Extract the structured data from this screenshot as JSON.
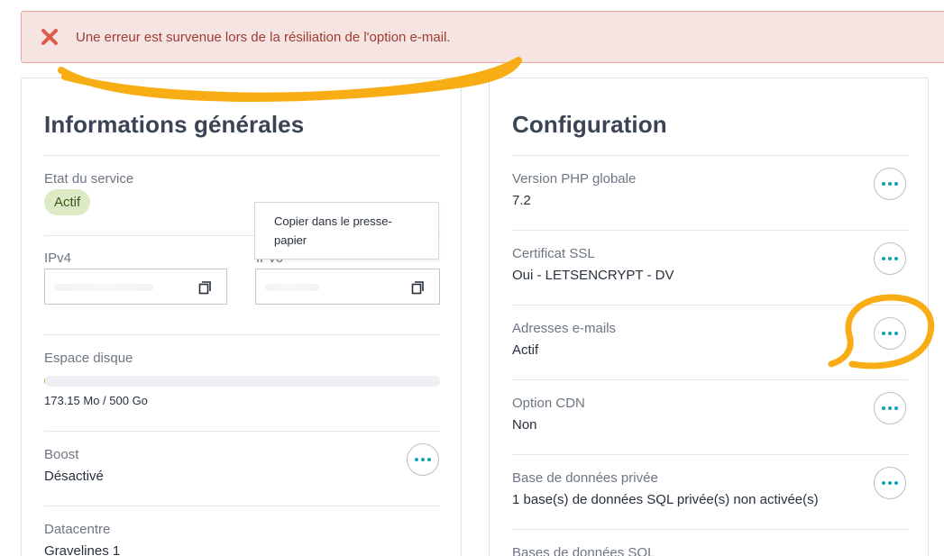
{
  "alert": {
    "message": "Une erreur est survenue lors de la résiliation de l'option e-mail.",
    "icon": "close-x-icon",
    "color": "#e05a4b"
  },
  "general": {
    "title": "Informations générales",
    "service_status_label": "Etat du service",
    "service_status_value": "Actif",
    "ipv4_label": "IPv4",
    "ipv6_label": "IPv6",
    "copy_tooltip": "Copier dans le presse-papier",
    "disk_label": "Espace disque",
    "disk_usage": "173.15 Mo / 500 Go",
    "disk_fraction": 0.00035,
    "boost_label": "Boost",
    "boost_value": "Désactivé",
    "datacenter_label": "Datacentre",
    "datacenter_value": "Gravelines 1"
  },
  "config": {
    "title": "Configuration",
    "rows": [
      {
        "label": "Version PHP globale",
        "value": "7.2"
      },
      {
        "label": "Certificat SSL",
        "value": "Oui - LETSENCRYPT - DV"
      },
      {
        "label": "Adresses e-mails",
        "value": "Actif"
      },
      {
        "label": "Option CDN",
        "value": "Non"
      },
      {
        "label": "Base de données privée",
        "value": "1 base(s) de données SQL privée(s) non activée(s)"
      },
      {
        "label": "Bases de données SQL",
        "value": ""
      }
    ]
  },
  "colors": {
    "accent": "#12a1b4",
    "highlight": "#f7a600",
    "badge_bg": "#dcebc5"
  }
}
